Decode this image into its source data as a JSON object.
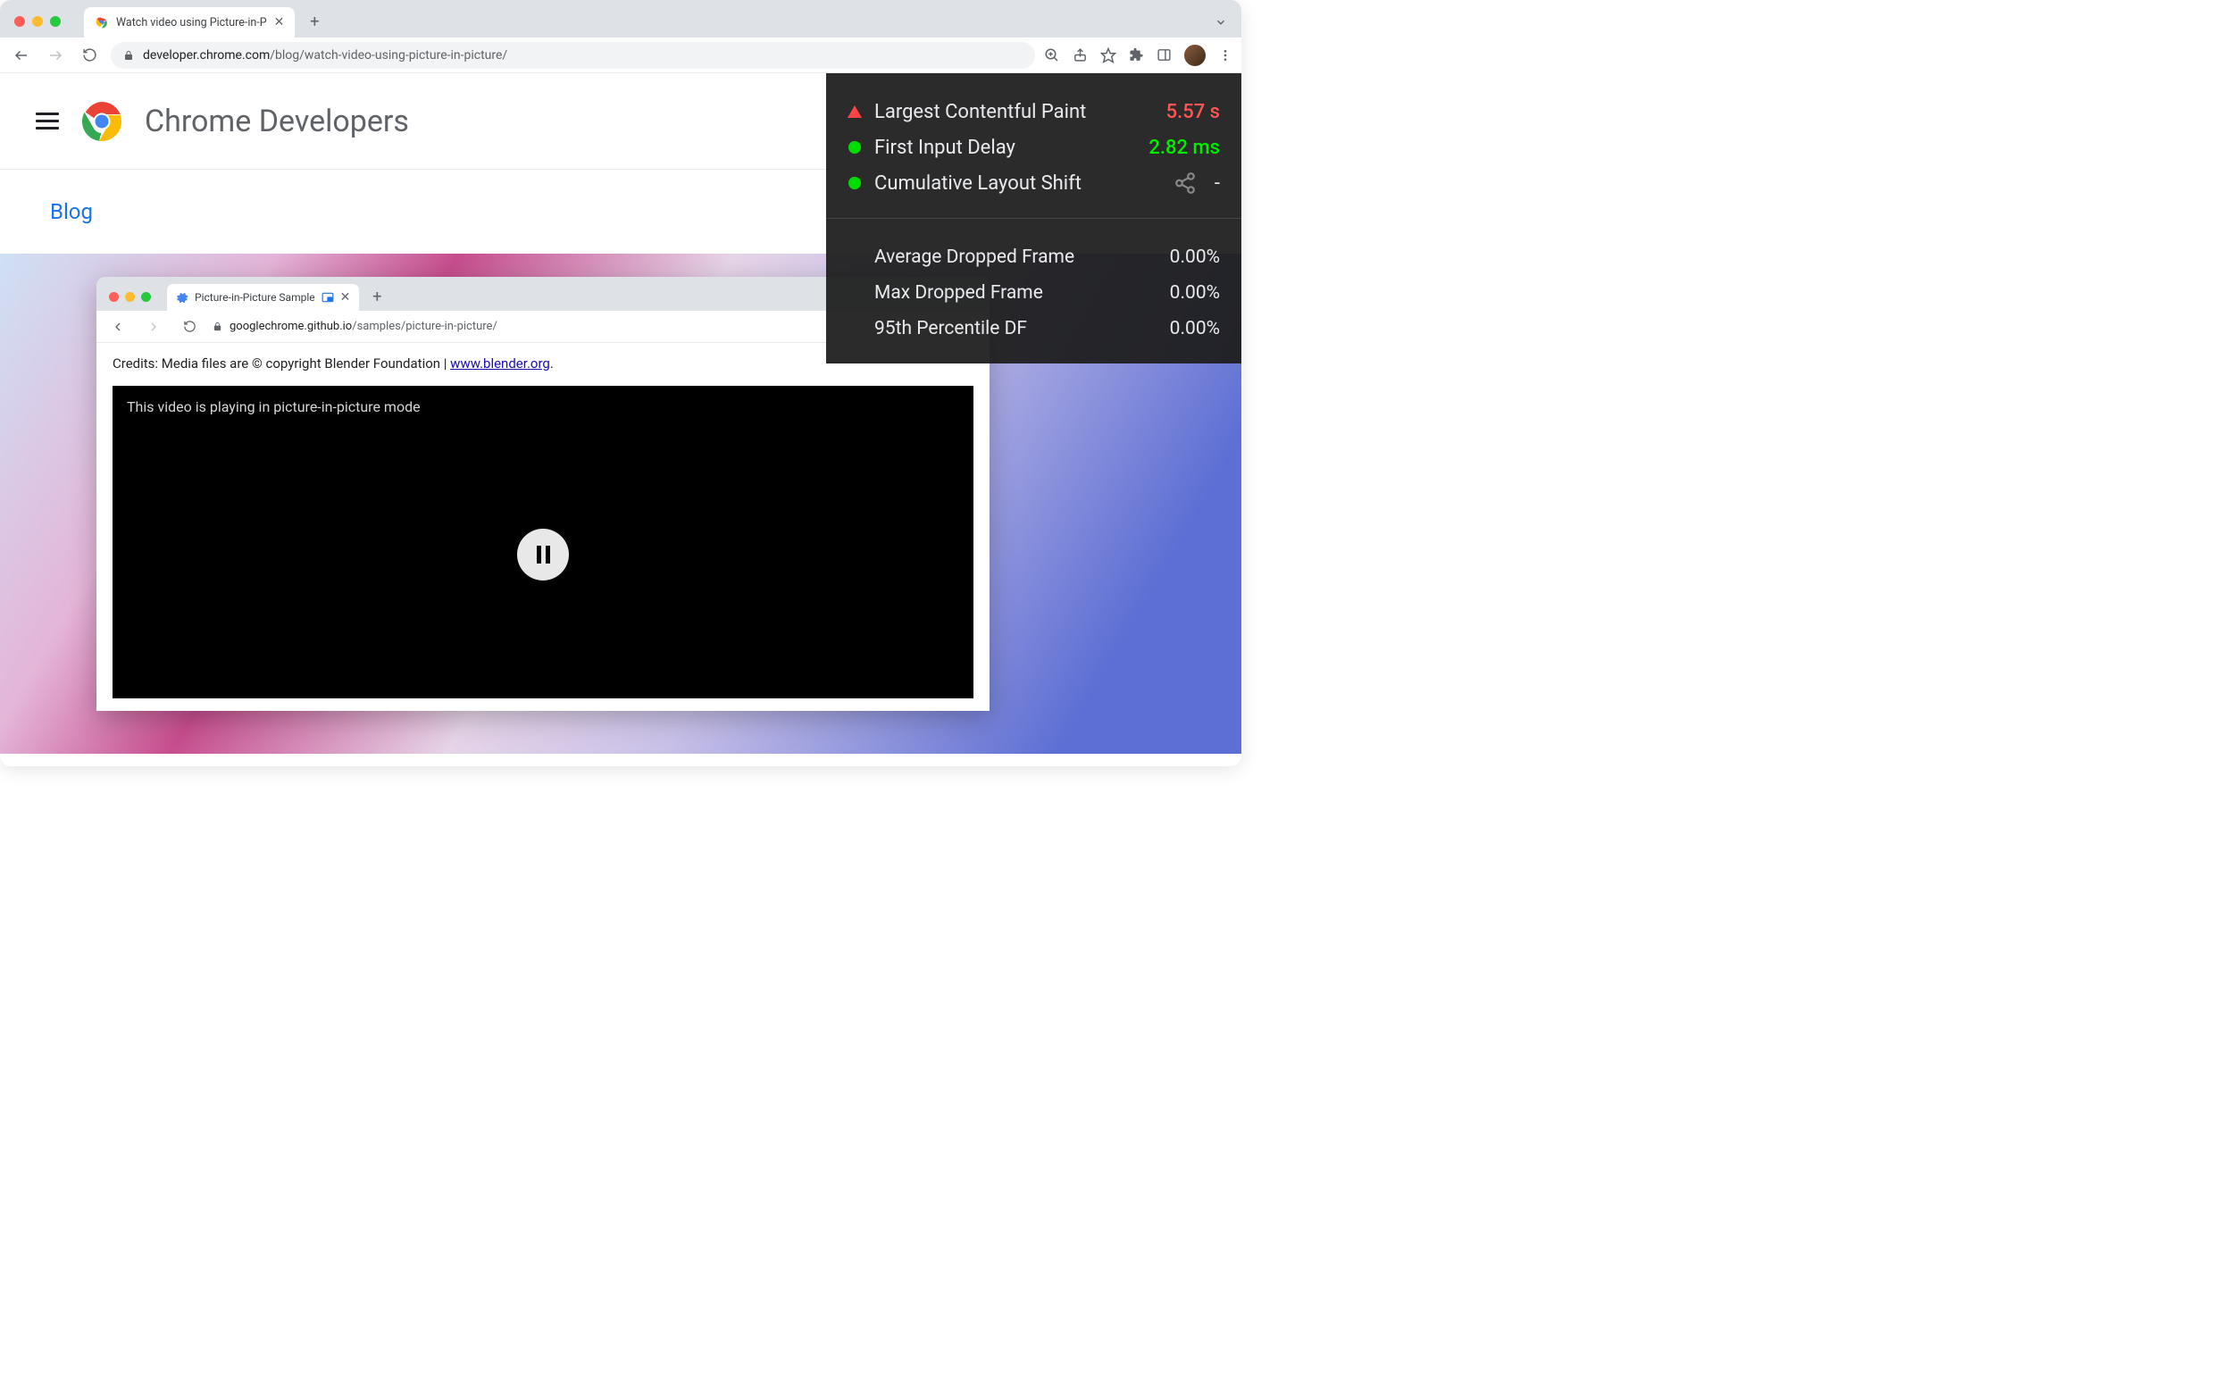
{
  "browser": {
    "tab_title": "Watch video using Picture-in-P",
    "url_host": "developer.chrome.com",
    "url_path": "/blog/watch-video-using-picture-in-picture/"
  },
  "site": {
    "title": "Chrome Developers",
    "nav_link": "Blog"
  },
  "inner": {
    "tab_title": "Picture-in-Picture Sample",
    "url_host": "googlechrome.github.io",
    "url_path": "/samples/picture-in-picture/",
    "credits_prefix": "Credits: Media files are © copyright Blender Foundation | ",
    "credits_link_text": "www.blender.org",
    "credits_suffix": ".",
    "pip_message": "This video is playing in picture-in-picture mode"
  },
  "overlay": {
    "vitals": [
      {
        "indicator": "triangle-red",
        "label": "Largest Contentful Paint",
        "value": "5.57 s",
        "value_class": "val-red"
      },
      {
        "indicator": "dot-green",
        "label": "First Input Delay",
        "value": "2.82 ms",
        "value_class": "val-green"
      },
      {
        "indicator": "dot-green",
        "label": "Cumulative Layout Shift",
        "value": "-",
        "value_class": ""
      }
    ],
    "frames": [
      {
        "label": "Average Dropped Frame",
        "value": "0.00%"
      },
      {
        "label": "Max Dropped Frame",
        "value": "0.00%"
      },
      {
        "label": "95th Percentile DF",
        "value": "0.00%"
      }
    ]
  }
}
